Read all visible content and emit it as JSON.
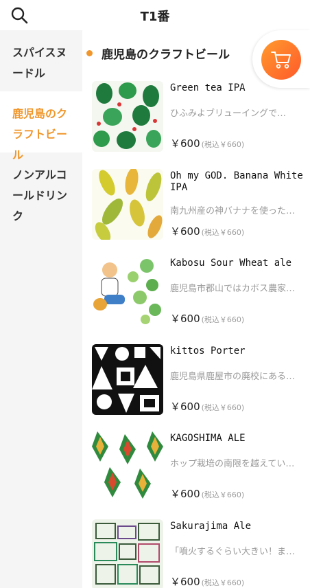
{
  "header": {
    "title": "T1番",
    "search_icon": "search-icon"
  },
  "categories": [
    {
      "label": "スパイスヌードル"
    },
    {
      "label": "鹿児島のクラフトビール"
    },
    {
      "label": "ノンアルコールドリンク"
    }
  ],
  "active_category": "鹿児島のクラフトビール",
  "section": {
    "title": "鹿児島のクラフトビール"
  },
  "cart": {
    "icon": "cart-icon"
  },
  "items": [
    {
      "name": "Green tea IPA",
      "desc": "ひふみよブリューイングで…",
      "price": "￥600",
      "tax": "(税込￥660)"
    },
    {
      "name": "Oh my GOD. Banana White IPA",
      "desc": "南九州産の神バナナを使った…",
      "price": "￥600",
      "tax": "(税込￥660)"
    },
    {
      "name": "Kabosu Sour Wheat ale",
      "desc": "鹿児島市郡山ではカボス農家…",
      "price": "￥600",
      "tax": "(税込￥660)"
    },
    {
      "name": "kittos Porter",
      "desc": "鹿児島県鹿屋市の廃校にある…",
      "price": "￥600",
      "tax": "(税込￥660)"
    },
    {
      "name": "KAGOSHIMA ALE",
      "desc": "ホップ栽培の南限を越えてい…",
      "price": "￥600",
      "tax": "(税込￥660)"
    },
    {
      "name": "Sakurajima Ale",
      "desc": "「噴火するぐらい大きい！ま…",
      "price": "￥600",
      "tax": "(税込￥660)"
    }
  ],
  "colors": {
    "accent": "#f0962a",
    "cart_gradient_start": "#ff9a2e",
    "cart_gradient_end": "#ff5a2a"
  }
}
